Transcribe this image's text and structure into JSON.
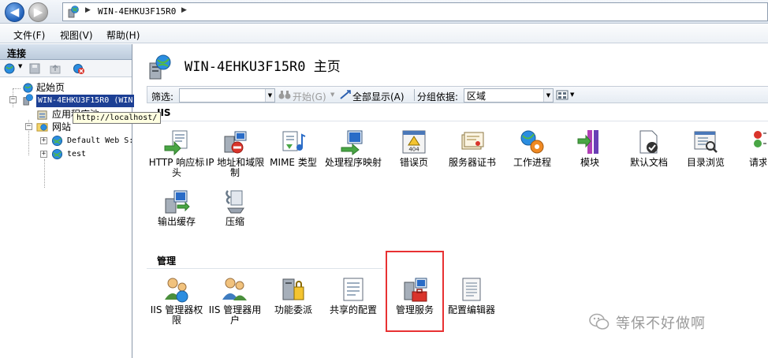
{
  "address": {
    "path": "WIN-4EHKU3F15R0",
    "sep": "▶",
    "back_glyph": "◀",
    "fwd_glyph": "▶"
  },
  "menu": {
    "items": [
      "文件(F)",
      "视图(V)",
      "帮助(H)"
    ]
  },
  "connections": {
    "title": "连接",
    "tree": {
      "start": "起始页",
      "server": "WIN-4EHKU3F15R0 (WIN",
      "apppool": "应用程序池",
      "sites": "网站",
      "site1": "Default Web S:",
      "site2": "test",
      "expand_minus": "−",
      "expand_plus": "+"
    },
    "tooltip": "http://localhost/"
  },
  "main": {
    "title": "WIN-4EHKU3F15R0 主页",
    "filter": {
      "label": "筛选:",
      "value": "",
      "start_label": "开始(G)",
      "showall_label": "全部显示(A)",
      "groupby_label": "分组依据:",
      "groupby_value": "区域"
    },
    "groups": {
      "iis": {
        "title": "IIS",
        "features": [
          "HTTP 响应标头",
          "IP 地址和域限制",
          "MIME 类型",
          "处理程序映射",
          "错误页",
          "服务器证书",
          "工作进程",
          "模块",
          "默认文档",
          "目录浏览",
          "请求",
          "输出缓存",
          "压缩"
        ]
      },
      "manage": {
        "title": "管理",
        "features": [
          "IIS 管理器权限",
          "IIS 管理器用户",
          "功能委派",
          "共享的配置",
          "管理服务",
          "配置编辑器"
        ]
      }
    }
  },
  "watermark": "等保不好做啊",
  "colors": {
    "selection": "#1c3f94",
    "highlight_border": "#e83132",
    "tooltip_bg": "#ffffe1"
  }
}
